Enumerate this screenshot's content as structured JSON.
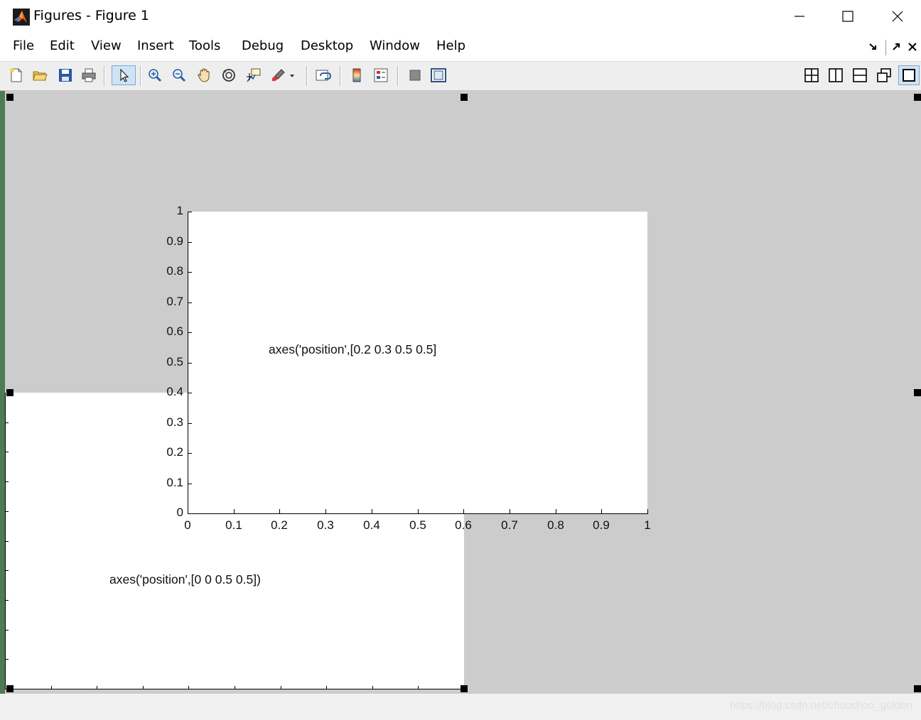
{
  "window": {
    "title": "Figures - Figure 1",
    "controls": [
      "minimize",
      "maximize",
      "close"
    ]
  },
  "menubar": {
    "items": [
      "File",
      "Edit",
      "View",
      "Insert",
      "Tools",
      "Debug",
      "Desktop",
      "Window",
      "Help"
    ]
  },
  "toolbar": {
    "buttons": [
      "new-figure-icon",
      "open-icon",
      "save-icon",
      "print-icon",
      "edit-plot-arrow-icon",
      "zoom-in-icon",
      "zoom-out-icon",
      "pan-hand-icon",
      "rotate-3d-icon",
      "data-cursor-icon",
      "brush-icon",
      "link-plot-icon",
      "colorbar-icon",
      "legend-icon",
      "hide-plot-tools-icon",
      "show-plot-tools-icon"
    ],
    "layout_buttons": [
      "tile-icon",
      "left-right-icon",
      "top-bottom-icon",
      "float-icon",
      "maximize-icon"
    ],
    "active": "edit-plot-arrow-icon"
  },
  "axes2": {
    "y_ticks": [
      "0",
      "0.1",
      "0.2",
      "0.3",
      "0.4",
      "0.5",
      "0.6",
      "0.7",
      "0.8",
      "0.9",
      "1"
    ],
    "x_ticks": [
      "0",
      "0.1",
      "0.2",
      "0.3",
      "0.4",
      "0.5",
      "0.6",
      "0.7",
      "0.8",
      "0.9",
      "1"
    ],
    "annotation": "axes('position',[0.2 0.3 0.5 0.5]"
  },
  "axes1": {
    "annotation": "axes('position',[0 0 0.5 0.5])"
  },
  "watermark": "https://blog.csdn.net/choochoo_golden"
}
